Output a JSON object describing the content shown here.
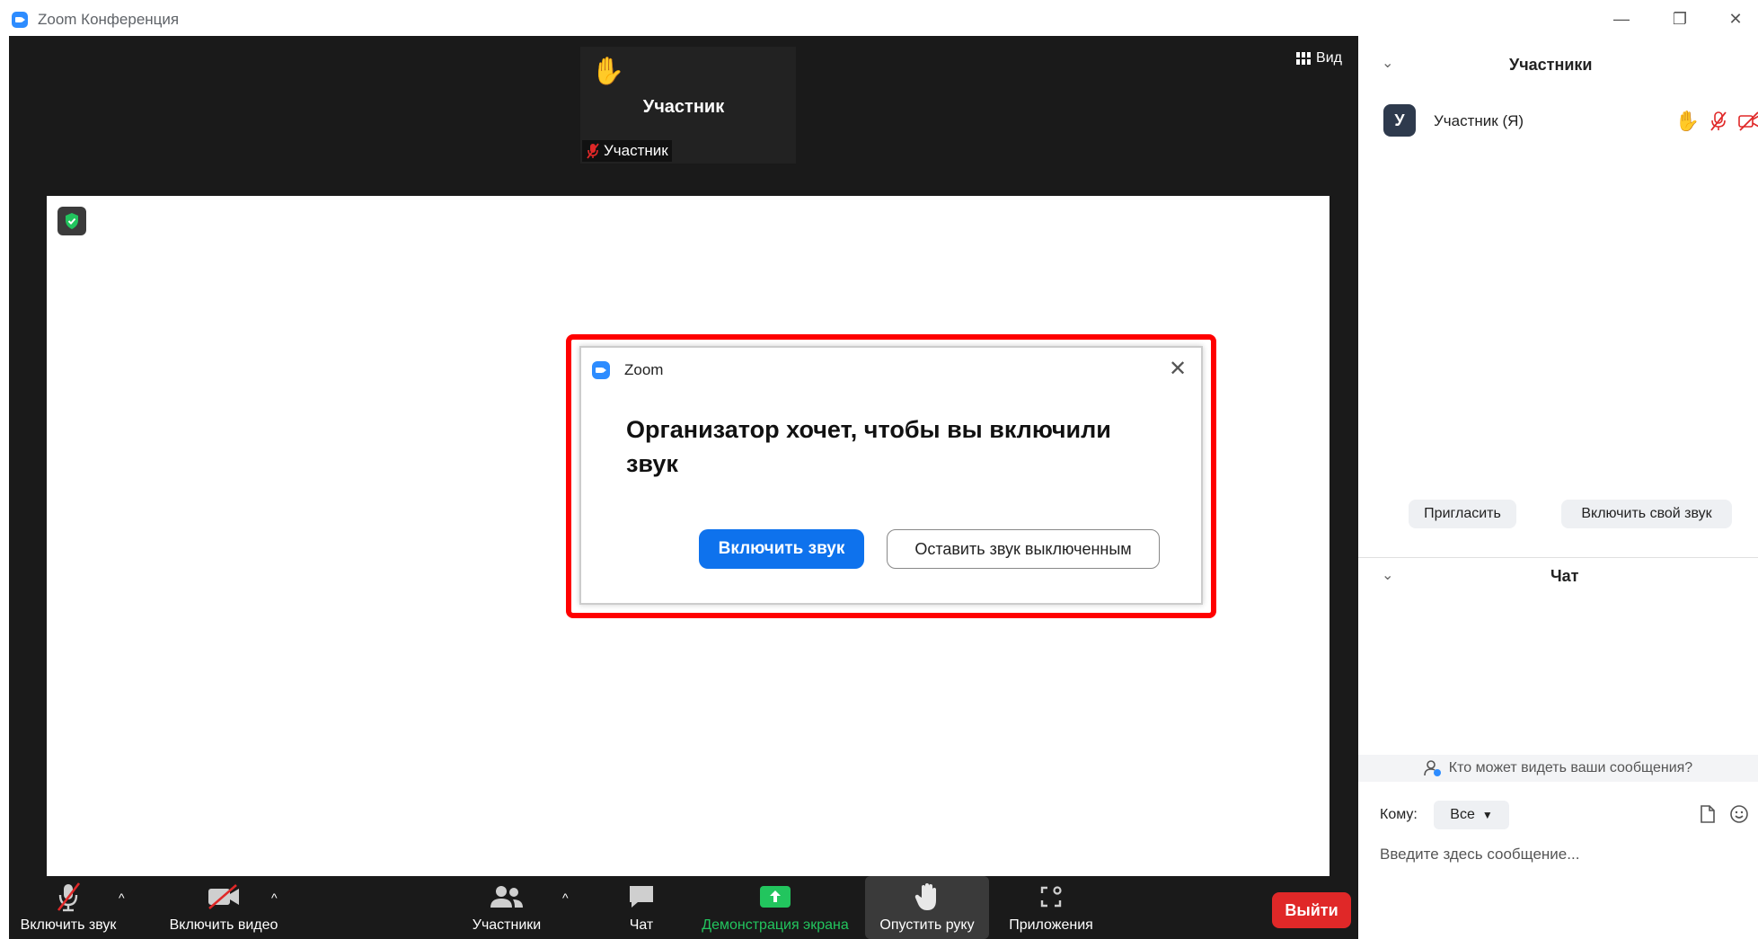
{
  "window": {
    "title": "Zoom Конференция",
    "minimize": "—",
    "restore": "❐",
    "close": "✕"
  },
  "meeting": {
    "view_label": "Вид",
    "thumbnail": {
      "name_large": "Участник",
      "name_small": "Участник"
    }
  },
  "dialog": {
    "title": "Zoom",
    "close": "✕",
    "message": "Организатор хочет, чтобы вы включили звук",
    "primary_button": "Включить звук",
    "secondary_button": "Оставить звук выключенным"
  },
  "toolbar": {
    "unmute": "Включить звук",
    "start_video": "Включить видео",
    "participants": "Участники",
    "chat": "Чат",
    "share_screen": "Демонстрация экрана",
    "lower_hand": "Опустить руку",
    "apps": "Приложения",
    "leave": "Выйти",
    "caret": "^"
  },
  "colors": {
    "share_green": "#22c55e",
    "leave_red": "#e02828",
    "primary_blue": "#0e72ed",
    "highlight_red": "#ff0000",
    "hand_yellow": "#f5b400",
    "muted_red": "#e02828"
  },
  "panel": {
    "participants_title": "Участники",
    "participant": {
      "avatar_letter": "У",
      "name": "Участник (Я)"
    },
    "invite_button": "Пригласить",
    "unmute_self_button": "Включить свой звук",
    "chat_title": "Чат",
    "who_sees": "Кто может видеть ваши сообщения?",
    "to_label": "Кому:",
    "to_value": "Все",
    "message_placeholder": "Введите здесь сообщение..."
  }
}
